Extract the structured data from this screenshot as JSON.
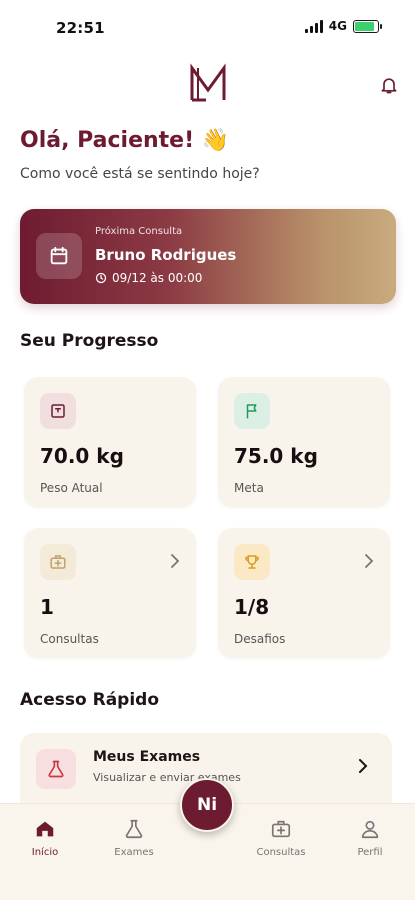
{
  "status_bar": {
    "time": "22:51",
    "network": "4G",
    "battery_percent": 85
  },
  "header": {
    "logo_text": "LM"
  },
  "greeting": {
    "title": "Olá, Paciente! 👋",
    "subtitle": "Como você está se sentindo hoje?"
  },
  "next_appointment": {
    "label": "Próxima Consulta",
    "name": "Bruno Rodrigues",
    "datetime": "09/12 às 00:00"
  },
  "progress": {
    "title": "Seu Progresso",
    "stats": [
      {
        "value": "70.0 kg",
        "label": "Peso Atual",
        "icon": "scale-icon",
        "color": "#6d1b30",
        "bg": "#f1dfe0"
      },
      {
        "value": "75.0 kg",
        "label": "Meta",
        "icon": "flag-icon",
        "color": "#1e9a5e",
        "bg": "#dcefe4"
      },
      {
        "value": "1",
        "label": "Consultas",
        "icon": "medical-case-icon",
        "color": "#c2a070",
        "bg": "#f3ead8"
      },
      {
        "value": "1/8",
        "label": "Desafios",
        "icon": "trophy-icon",
        "color": "#d99b1e",
        "bg": "#fbe9c6"
      }
    ]
  },
  "quick_access": {
    "title": "Acesso Rápido",
    "items": [
      {
        "title": "Meus Exames",
        "subtitle": "Visualizar e enviar exames",
        "icon": "flask-icon"
      }
    ]
  },
  "fab": {
    "label": "Ni"
  },
  "tabbar": {
    "tabs": [
      {
        "label": "Início",
        "icon": "home-icon",
        "active": true
      },
      {
        "label": "Exames",
        "icon": "flask-icon",
        "active": false
      },
      {
        "label": "Consultas",
        "icon": "medical-case-icon",
        "active": false
      },
      {
        "label": "Perfil",
        "icon": "person-icon",
        "active": false
      }
    ]
  },
  "colors": {
    "brand": "#6d1b30",
    "gold": "#c9ab7f",
    "card_bg": "#f8f4ec"
  }
}
